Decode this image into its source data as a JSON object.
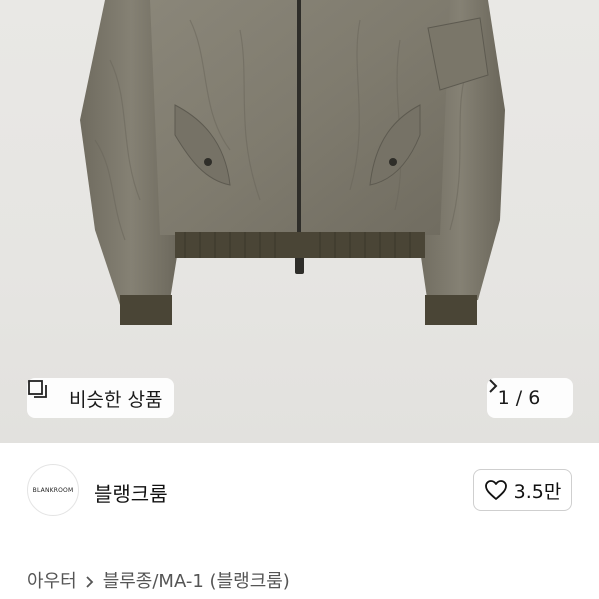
{
  "product_image": {
    "similar_button_label": "비슷한 상품",
    "page_indicator": "1 / 6",
    "icons": {
      "similar": "similar-items-icon",
      "next": "chevron-right-icon"
    }
  },
  "brand": {
    "logo_text": "BLANKROOM",
    "name": "블랭크룸",
    "like_count": "3.5만",
    "like_icon": "heart-outline-icon"
  },
  "breadcrumb": {
    "items": [
      "아우터",
      "블루종/MA-1 (블랭크룸)"
    ]
  }
}
